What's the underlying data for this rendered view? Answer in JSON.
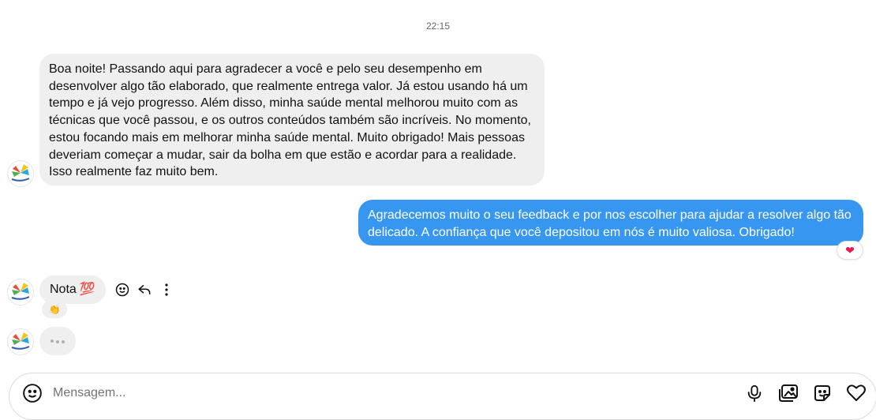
{
  "thread": {
    "timestamp": "22:15",
    "messages": [
      {
        "direction": "incoming",
        "text": "Boa noite! Passando aqui para agradecer a você e pelo seu desempenho em desenvolver algo tão elaborado, que realmente entrega valor. Já estou usando há um tempo e já vejo progresso. Além disso, minha saúde mental melhorou muito com as técnicas que você passou, e os outros conteúdos também são incríveis. No momento, estou focando mais em melhorar minha saúde mental. Muito obrigado! Mais pessoas deveriam começar a mudar, sair da bolha em que estão e acordar para a realidade. Isso realmente faz muito bem."
      },
      {
        "direction": "outgoing",
        "text": "Agradecemos muito o seu feedback e por nos escolher para ajudar a resolver algo tão delicado. A confiança que você depositou em nós é muito valiosa. Obrigado!",
        "reaction": "❤"
      },
      {
        "direction": "incoming",
        "text": "Nota",
        "emoji": "💯",
        "reaction": "👏"
      }
    ]
  },
  "composer": {
    "placeholder": "Mensagem..."
  },
  "colors": {
    "outgoing_bubble": "#3797f0",
    "incoming_bubble": "#efefef",
    "heart": "#ed1650"
  },
  "icons": [
    "avatar",
    "emoji-icon",
    "reply-icon",
    "more-icon",
    "microphone-icon",
    "image-icon",
    "sticker-icon",
    "heart-icon"
  ]
}
